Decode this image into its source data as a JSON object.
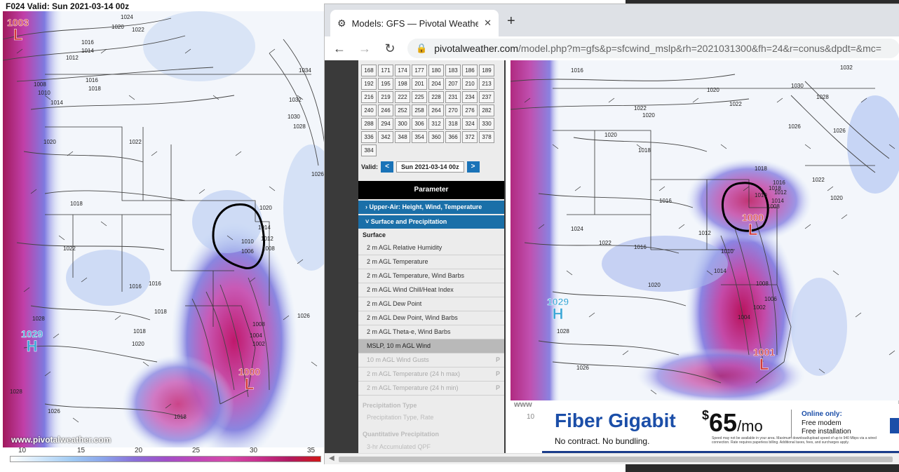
{
  "left_map": {
    "header": "F024 Valid: Sun 2021-03-14 00z",
    "watermark": "www.pivotalweather.com",
    "colorbar_ticks": [
      "10",
      "15",
      "20",
      "25",
      "30",
      "35"
    ],
    "low_top": {
      "value": "1003",
      "symbol": "L"
    },
    "low_main": {
      "value": "1000",
      "symbol": "L"
    },
    "high_main": {
      "value": "1029",
      "symbol": "H"
    },
    "isobar_labels": [
      "1024",
      "1022",
      "1020",
      "1016",
      "1014",
      "1012",
      "1008",
      "1010",
      "1016",
      "1018",
      "1014",
      "1034",
      "1032",
      "1030",
      "1028",
      "1020",
      "1022",
      "1026",
      "1018",
      "1020",
      "1014",
      "1012",
      "1010",
      "1008",
      "1006",
      "1022",
      "1016",
      "1018",
      "1028",
      "1026",
      "1008",
      "1004",
      "1002",
      "1016",
      "1018",
      "1020",
      "1026",
      "1028",
      "1018"
    ]
  },
  "browser": {
    "tab_title": "Models: GFS — Pivotal Weather",
    "tab_close": "✕",
    "new_tab": "+",
    "url_host": "pivotalweather.com",
    "url_path": "/model.php?m=gfs&p=sfcwind_mslp&rh=2021031300&fh=24&r=conus&dpdt=&mc=",
    "back": "←",
    "forward": "→",
    "reload": "↻",
    "lock": "🔒"
  },
  "sidebar": {
    "hours": [
      "168",
      "171",
      "174",
      "177",
      "180",
      "183",
      "186",
      "189",
      "192",
      "195",
      "198",
      "201",
      "204",
      "207",
      "210",
      "213",
      "216",
      "219",
      "222",
      "225",
      "228",
      "231",
      "234",
      "237",
      "240",
      "246",
      "252",
      "258",
      "264",
      "270",
      "276",
      "282",
      "288",
      "294",
      "300",
      "306",
      "312",
      "318",
      "324",
      "330",
      "336",
      "342",
      "348",
      "354",
      "360",
      "366",
      "372",
      "378",
      "384"
    ],
    "valid_label": "Valid:",
    "valid_prev": "<",
    "valid_date": "Sun 2021-03-14 00z",
    "valid_next": ">",
    "parameter_header": "Parameter",
    "acc_upper": "Upper-Air: Height, Wind, Temperature",
    "acc_surface": "Surface and Precipitation",
    "surface_label": "Surface",
    "params": [
      {
        "label": "2 m AGL Relative Humidity",
        "state": "normal",
        "p": ""
      },
      {
        "label": "2 m AGL Temperature",
        "state": "normal",
        "p": ""
      },
      {
        "label": "2 m AGL Temperature, Wind Barbs",
        "state": "normal",
        "p": ""
      },
      {
        "label": "2 m AGL Wind Chill/Heat Index",
        "state": "normal",
        "p": ""
      },
      {
        "label": "2 m AGL Dew Point",
        "state": "normal",
        "p": ""
      },
      {
        "label": "2 m AGL Dew Point, Wind Barbs",
        "state": "normal",
        "p": ""
      },
      {
        "label": "2 m AGL Theta-e, Wind Barbs",
        "state": "normal",
        "p": ""
      },
      {
        "label": "MSLP, 10 m AGL Wind",
        "state": "selected",
        "p": ""
      },
      {
        "label": "10 m AGL Wind Gusts",
        "state": "faded",
        "p": "P"
      },
      {
        "label": "2 m AGL Temperature (24 h max)",
        "state": "faded",
        "p": "P"
      },
      {
        "label": "2 m AGL Temperature (24 h min)",
        "state": "faded",
        "p": "P"
      }
    ],
    "precip_type_label": "Precipitation Type",
    "precip_type_item": "Precipitation Type, Rate",
    "quant_label": "Quantitative Precipitation",
    "quant_item": "3-hr Accumulated QPF"
  },
  "right_map": {
    "low_main": {
      "value": "1000",
      "symbol": "L"
    },
    "low_east": {
      "value": "1001",
      "symbol": "L"
    },
    "high_main": {
      "value": "1029",
      "symbol": "H"
    },
    "isobar_labels": [
      "1016",
      "1020",
      "1022",
      "1022",
      "1030",
      "1028",
      "1032",
      "1026",
      "1026",
      "1020",
      "1018",
      "1018",
      "1020",
      "1022",
      "1018",
      "1016",
      "1014",
      "1012",
      "1010",
      "1008",
      "1016",
      "1020",
      "1012",
      "1024",
      "1022",
      "1016",
      "1010",
      "1014",
      "1008",
      "1006",
      "1020",
      "1004",
      "1002",
      "1028",
      "1026"
    ],
    "overlay_text": "www",
    "overlay_10": "10"
  },
  "ad": {
    "headline": "Fiber Gigabit",
    "subline": "No contract. No bundling.",
    "price_dollar": "$",
    "price_amount": "65",
    "price_per": "/mo",
    "online_only": "Online only:",
    "benefit1": "Free modem",
    "benefit2": "Free installation",
    "fine_print": "Speed may not be available in your area. Maximum download/upload speed of up to 940 Mbps via a wired connection. Rate requires paperless billing. Additional taxes, fees, and surcharges apply."
  },
  "colors": {
    "low": "#d23a3a",
    "high": "#3aa6d6",
    "accent": "#1a6fa8",
    "ad_blue": "#1b4ea8"
  }
}
